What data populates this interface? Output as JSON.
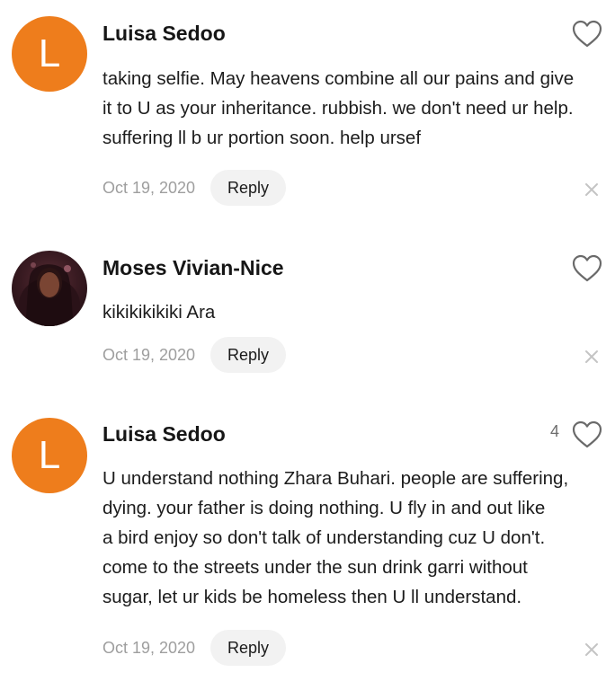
{
  "comments": [
    {
      "username": "Luisa Sedoo",
      "avatar_letter": "L",
      "text": "taking selfie. May heavens combine all our pains and give\nit to U as your inheritance. rubbish. we don't need ur help.\nsuffering ll b ur portion  soon. help ursef",
      "date": "Oct 19, 2020",
      "reply_label": "Reply"
    },
    {
      "username": "Moses Vivian-Nice",
      "text": "kikikikikiki Ara",
      "date": "Oct 19, 2020",
      "reply_label": "Reply"
    },
    {
      "username": "Luisa Sedoo",
      "avatar_letter": "L",
      "likes": "4",
      "text": "U understand nothing Zhara Buhari. people are suffering,\ndying. your father is doing nothing. U fly in and out like\na bird enjoy so don't talk of understanding cuz U don't.\ncome to the streets under the sun drink garri without\nsugar, let ur kids be homeless then U ll understand.",
      "date": "Oct 19, 2020",
      "reply_label": "Reply"
    }
  ],
  "icons": {
    "like": "heart-outline-icon",
    "dismiss": "close-icon"
  },
  "colors": {
    "avatar_orange": "#ee7d1c",
    "reply_bg": "#f2f2f2",
    "muted_text": "#9e9e9e"
  }
}
